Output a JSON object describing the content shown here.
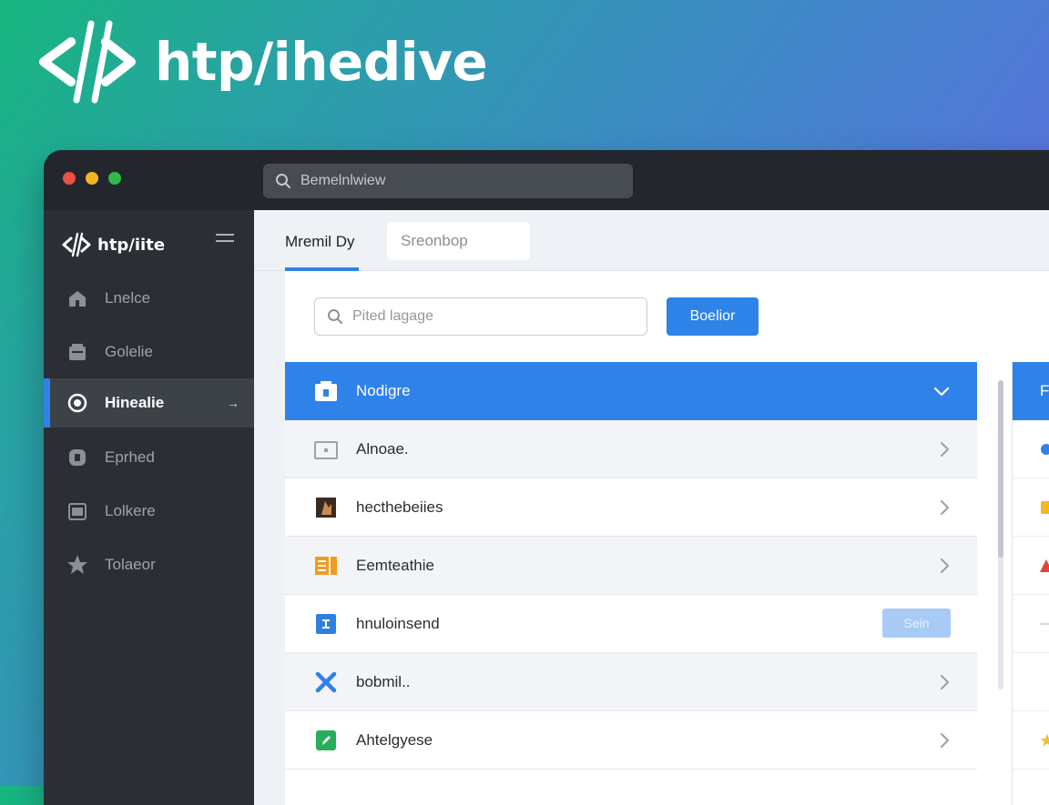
{
  "brand": {
    "title": "htp/ihedive",
    "logo_icon": "code-brackets-icon"
  },
  "window": {
    "search": {
      "placeholder": "Bemelnlwiew",
      "icon": "search-icon"
    },
    "sidebar": {
      "app_name": "htp/iite",
      "items": [
        {
          "label": "Lnelce",
          "icon": "home-icon"
        },
        {
          "label": "Golelie",
          "icon": "inbox-icon"
        },
        {
          "label": "Hinealie",
          "icon": "target-icon",
          "active": true,
          "arrow": "→"
        },
        {
          "label": "Eprhed",
          "icon": "badge-icon"
        },
        {
          "label": "Lolkere",
          "icon": "calendar-icon"
        },
        {
          "label": "Tolaeor",
          "icon": "star-icon"
        }
      ]
    },
    "main": {
      "tabs": [
        {
          "label": "Mremil Dy",
          "active": true
        },
        {
          "label": "Sreonbop"
        }
      ],
      "filter": {
        "placeholder": "Pited lagage"
      },
      "primary_button": "Boelior",
      "rows": [
        {
          "label": "Nodigre",
          "icon": "lock-icon"
        },
        {
          "label": "Alnoae.",
          "icon": "folder-icon"
        },
        {
          "label": "hecthebeiies",
          "icon": "image-icon"
        },
        {
          "label": "Eemteathie",
          "icon": "grid-icon"
        },
        {
          "label": "hnuloinsend",
          "icon": "text-icon",
          "button": "Sein"
        },
        {
          "label": "bobmil..",
          "icon": "cross-icon"
        },
        {
          "label": "Ahtelgyese",
          "icon": "edit-icon"
        }
      ],
      "right_panel_head": "F"
    }
  },
  "colors": {
    "accent": "#2e83e8",
    "sidebar_bg": "#2b2f35",
    "titlebar_bg": "#23272d"
  }
}
